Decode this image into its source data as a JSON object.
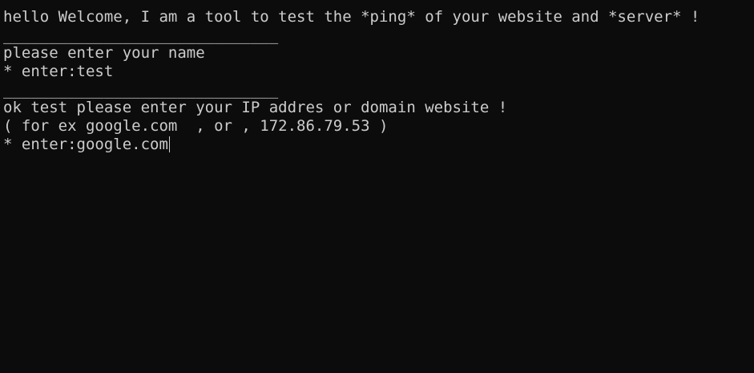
{
  "terminal": {
    "lines": [
      "hello Welcome, I am a tool to test the *ping* of your website and *server* !",
      "______________________________",
      "please enter your name",
      "* enter:test",
      "______________________________",
      "ok test please enter your IP addres or domain website !",
      "( for ex google.com  , or , 172.86.79.53 )",
      "* enter:google.com"
    ]
  }
}
